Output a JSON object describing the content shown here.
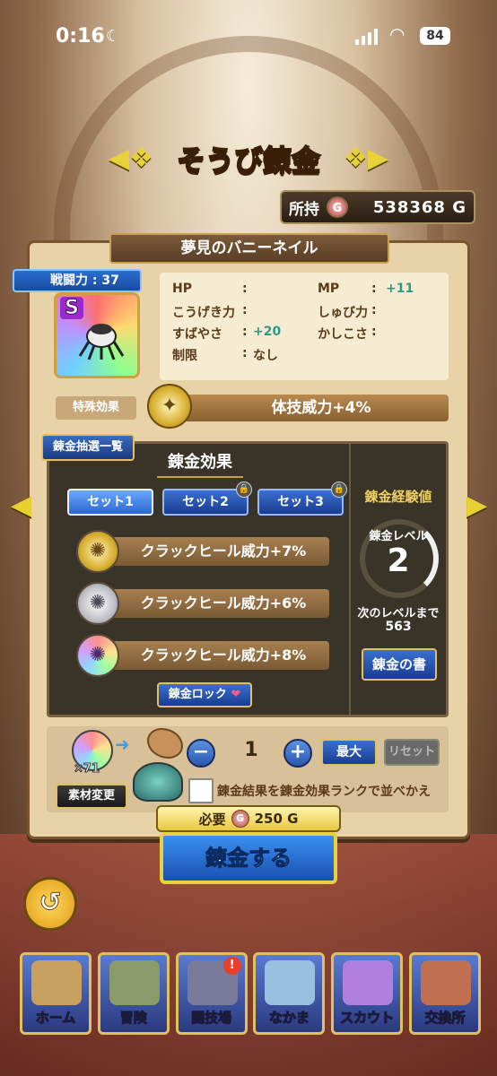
{
  "status_bar": {
    "time": "0:16",
    "battery": "84"
  },
  "title": "そうび錬金",
  "gold": {
    "label": "所持",
    "icon": "G",
    "value": "538368 G"
  },
  "item": {
    "name": "夢見のバニーネイル",
    "power_label": "戦闘力 : 37",
    "rank": "S",
    "stats": {
      "hp_label": "HP",
      "hp_value": "",
      "mp_label": "MP",
      "mp_value": "+11",
      "atk_label": "こうげき力",
      "atk_value": "",
      "def_label": "しゅび力",
      "def_value": "",
      "spd_label": "すばやさ",
      "spd_value": "+20",
      "wis_label": "かしこさ",
      "wis_value": "",
      "limit_label": "制限",
      "limit_value": "なし",
      "colon": ":"
    },
    "special_label": "特殊効果",
    "special_value": "体技威力+4%"
  },
  "effects": {
    "lottery_tab": "錬金抽選一覧",
    "title": "錬金効果",
    "sets": [
      "セット1",
      "セット2",
      "セット3"
    ],
    "rows": [
      {
        "text": "クラックヒール威力+7%",
        "medal": "gold"
      },
      {
        "text": "クラックヒール威力+6%",
        "medal": "silver"
      },
      {
        "text": "クラックヒール威力+8%",
        "medal": "rainbow"
      }
    ],
    "lock_button": "錬金ロック",
    "exp_title": "錬金経験値",
    "level_label": "錬金レベル",
    "level_value": "2",
    "next_label": "次のレベルまで",
    "next_value": "563",
    "book_button": "錬金の書"
  },
  "material": {
    "count": "×71",
    "change_button": "素材変更",
    "quantity": "1",
    "max_button": "最大",
    "reset_button": "リセット",
    "sort_label": "錬金結果を錬金効果ランクで並べかえ"
  },
  "cost": {
    "label": "必要",
    "value": "250 G"
  },
  "alchemy_button": "錬金する",
  "nav": [
    {
      "label": "ホーム",
      "color": "#c8a060"
    },
    {
      "label": "冒険",
      "color": "#8a9a6a"
    },
    {
      "label": "闘技場",
      "color": "#7a7a9a",
      "alert": "!"
    },
    {
      "label": "なかま",
      "color": "#9ac0e0"
    },
    {
      "label": "スカウト",
      "color": "#b080e0"
    },
    {
      "label": "交換所",
      "color": "#c07050"
    }
  ]
}
